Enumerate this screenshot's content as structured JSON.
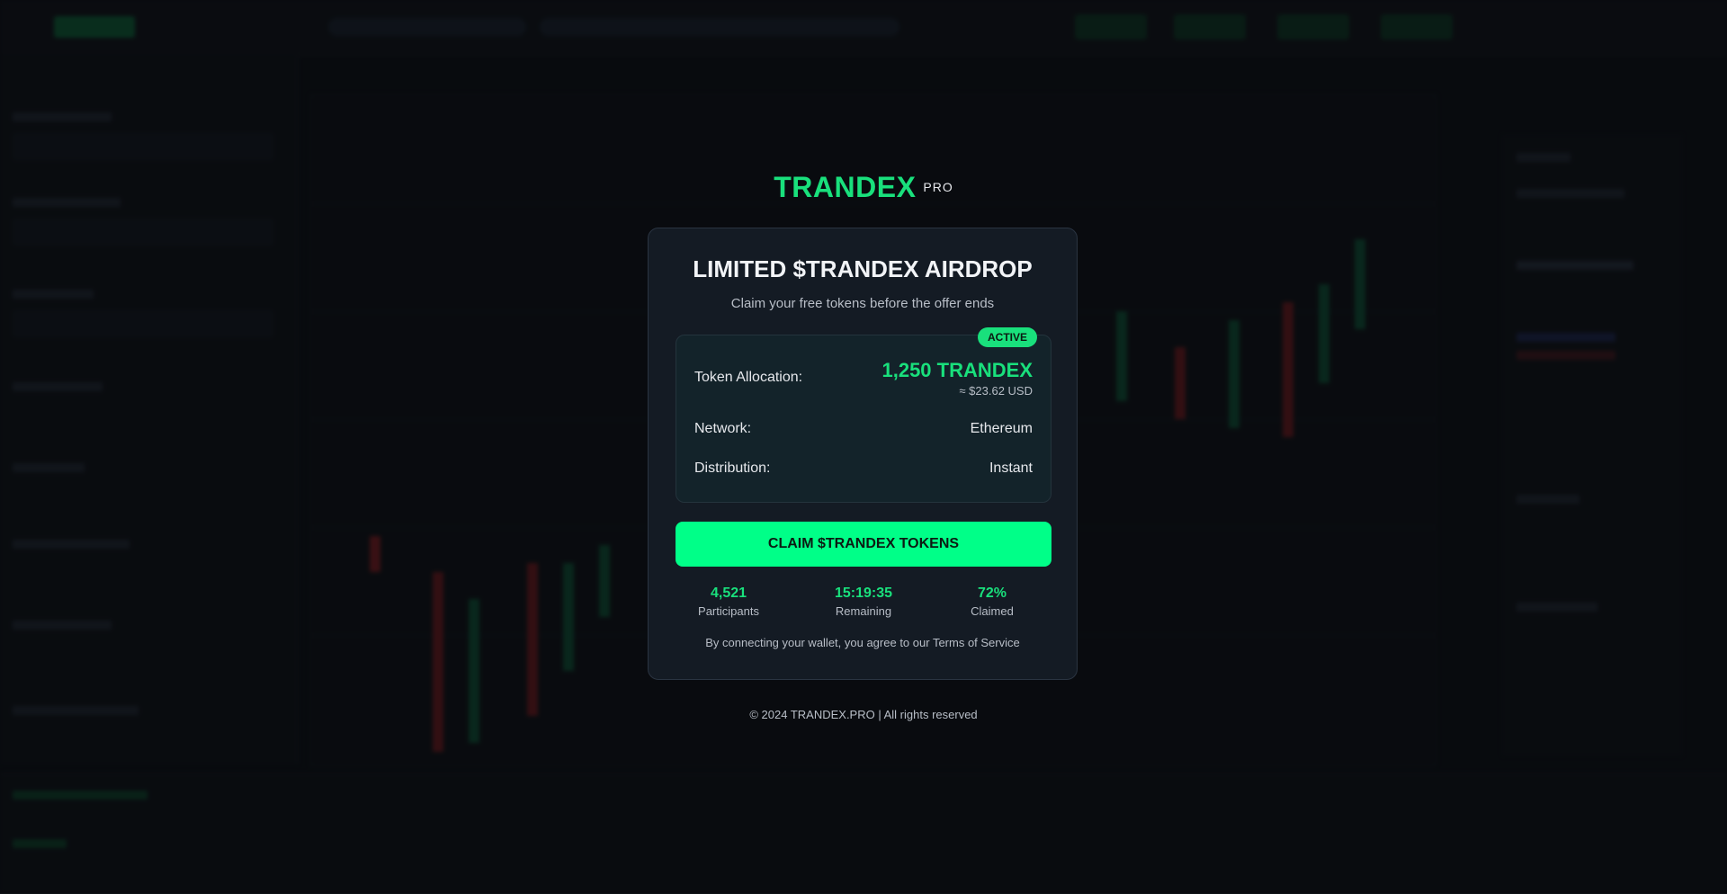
{
  "colors": {
    "accent": "#19e07c",
    "button": "#00ff88",
    "panel": "#141b24",
    "overlay": "#0d1014"
  },
  "brand": {
    "name": "TRANDEX",
    "tag": "PRO"
  },
  "modal": {
    "title": "LIMITED $TRANDEX AIRDROP",
    "subtitle": "Claim your free tokens before the offer ends",
    "badge": "ACTIVE",
    "allocation": {
      "label": "Token Allocation:",
      "value": "1,250 TRANDEX",
      "usd": "≈ $23.62 USD"
    },
    "network": {
      "label": "Network:",
      "value": "Ethereum"
    },
    "distribution": {
      "label": "Distribution:",
      "value": "Instant"
    },
    "claim_label": "CLAIM $TRANDEX TOKENS",
    "stats": [
      {
        "value": "4,521",
        "label": "Participants"
      },
      {
        "value": "15:19:35",
        "label": "Remaining"
      },
      {
        "value": "72%",
        "label": "Claimed"
      }
    ],
    "terms": "By connecting your wallet, you agree to our Terms of Service"
  },
  "footer": "© 2024 TRANDEX.PRO | All rights reserved"
}
